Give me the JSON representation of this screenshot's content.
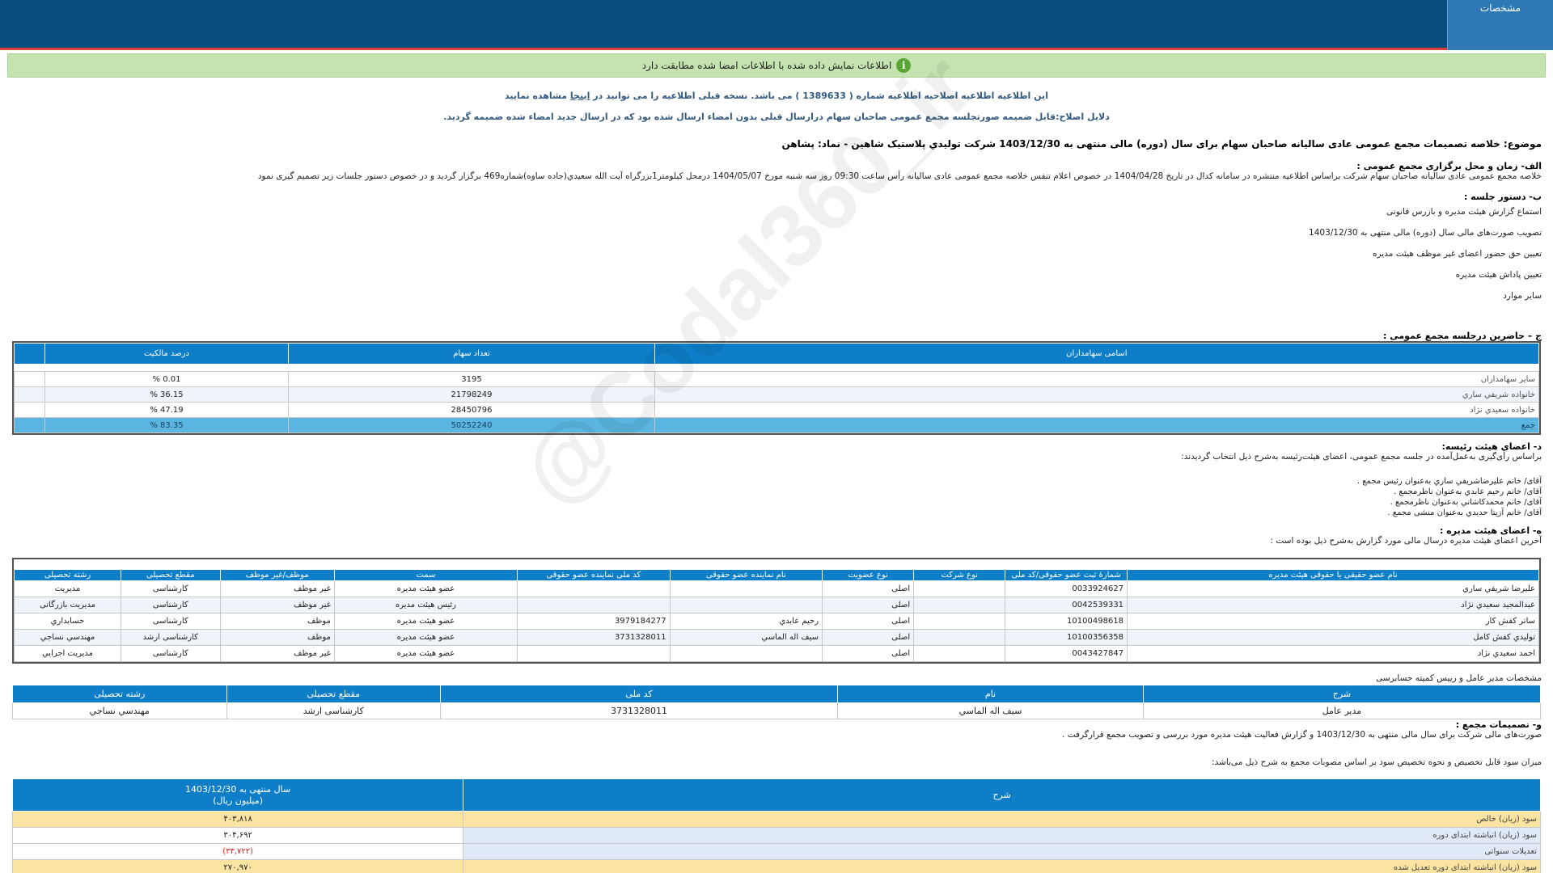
{
  "header": {
    "tab_label": "مشخصات"
  },
  "match_bar": {
    "text": "اطلاعات نمایش داده شده با اطلاعات امضا شده مطابقت دارد",
    "icon": "info-icon"
  },
  "notice": {
    "line1_a": "این اطلاعیه اطلاعیه اصلاحیه اطلاعیه شماره ( 1389633 ) می باشد. نسخه قبلی اطلاعیه را می توانید در",
    "link": "اینجا",
    "line1_b": "مشاهده نمایید",
    "line2": "دلایل اصلاح:قابل ضمیمه صورتجلسه مجمع عمومی صاحبان سهام درارسال قبلی بدون امضاء ارسال شده بود که در ارسال جدید امضاء شده ضمیمه گردید."
  },
  "subject": "موضوع: خلاصه تصمیمات مجمع عمومی عادی سالیانه صاحبان سهام برای سال (دوره) مالی منتهی به 1403/12/30 شرکت تولیدي پلاستیک شاهین - نماد: پشاهن",
  "section_a": {
    "title": "الف- زمان و محل برگزاری مجمع عمومی :",
    "text": "خلاصه مجمع عمومی عادی سالیانه صاحبان سهام شرکت براساس اطلاعیه منتشره در سامانه کدال در تاریخ 1404/04/28 در خصوص اعلام تنفس خلاصه مجمع عمومی عادی سالیانه رأس ساعت 09:30 روز سه شنبه مورخ 1404/05/07 درمحل  کیلومتر1بزرگراه آیت الله سعیدي(جاده ساوه)شماره469   برگزار گردید و در خصوص دستور جلسات زیر تصمیم گیری نمود"
  },
  "section_b": {
    "title": "ب- دستور جلسه :",
    "items": [
      "استماع گزارش هیئت مدیره و بازرس قانونی",
      "تصویب صورت‌های مالی سال (دوره) مالی منتهی به 1403/12/30",
      "تعیین حق حضور اعضای غیر موظف هیئت مدیره",
      "تعیین پاداش هیئت مدیره",
      "سایر موارد"
    ]
  },
  "section_c": {
    "title": "ج – حاضرین درجلسه مجمع عمومی :",
    "headers": [
      "اسامی سهامداران",
      "تعداد سهام",
      "درصد مالکیت"
    ],
    "rows": [
      [
        "سایر سهامداران",
        "3195",
        "0.01 %"
      ],
      [
        "خانواده شریفي ساري",
        "21798249",
        "36.15 %"
      ],
      [
        "خانواده سعیدي نژاد",
        "28450796",
        "47.19 %"
      ]
    ],
    "total": [
      "جمع",
      "50252240",
      "83.35 %"
    ]
  },
  "section_d": {
    "title": "د- اعضای هیئت رئیسه:",
    "intro": "براساس رأی‌گیری به‌عمل‌آمده در جلسه مجمع عمومی، اعضای هیئت‌رئیسه به‌شرح ذیل انتخاب گردیدند:",
    "members": [
      "آقای/ خانم  علیرضاشریفي ساري  به‌عنوان رئیس مجمع .",
      "آقای/ خانم  رحیم عابدي  به‌عنوان ناظرمجمع .",
      "آقای/ خانم  محمدکاشاني  به‌عنوان ناظرمجمع .",
      "آقای/ خانم  آزیتا حدیدي  به‌عنوان منشی مجمع ."
    ]
  },
  "section_e": {
    "title": "ه- اعضای هیئت مدیره :",
    "intro": "آخرین اعضای هیئت مدیره درسال مالی مورد گزارش به‌شرح ذیل بوده است :",
    "headers": [
      "نام عضو حقیقی یا حقوقی هیئت مدیره",
      "شمارۀ ثبت عضو حقوقی/کد ملی",
      "نوع شرکت",
      "نوع عضویت",
      "نام نماینده عضو حقوقی",
      "کد ملی نماینده عضو حقوقی",
      "سمت",
      "موظف/غیر موظف",
      "مقطع تحصیلی",
      "رشته تحصیلی"
    ],
    "rows": [
      [
        "علیرضا شریفي ساري",
        "0033924627",
        "",
        "اصلی",
        "",
        "",
        "عضو هیئت مدیره",
        "غیر موظف",
        "کارشناسی",
        "مدیریت"
      ],
      [
        "عبدالمجید سعیدي نژاد",
        "0042539331",
        "",
        "اصلی",
        "",
        "",
        "رئیس هیئت مدیره",
        "غیر موظف",
        "کارشناسی",
        "مدیریت بازرگانی"
      ],
      [
        "ساتر کفش کار",
        "10100498618",
        "",
        "اصلی",
        "رحیم عابدي",
        "3979184277",
        "عضو هیئت مدیره",
        "موظف",
        "کارشناسی",
        "حسابداري"
      ],
      [
        "تولیدي کفش کامل",
        "10100356358",
        "",
        "اصلی",
        "سیف اله الماسي",
        "3731328011",
        "عضو هیئت مدیره",
        "موظف",
        "کارشناسی ارشد",
        "مهندسي نساجي"
      ],
      [
        "احمد سعیدي نژاد",
        "0043427847",
        "",
        "اصلی",
        "",
        "",
        "عضو هیئت مدیره",
        "غیر موظف",
        "کارشناسی",
        "مدیریت اجرایي"
      ]
    ]
  },
  "ceo": {
    "title": "مشخصات مدیر عامل و رییس کمیته حسابرسی",
    "headers": [
      "شرح",
      "نام",
      "کد ملی",
      "مقطع تحصیلی",
      "رشته تحصیلی"
    ],
    "row": [
      "مدیر عامل",
      "سیف اله الماسي",
      "3731328011",
      "کارشناسی ارشد",
      "مهندسي نساجي"
    ]
  },
  "section_f": {
    "title": "و- تصمیمات مجمع :",
    "text": "صورت‌های مالی شرکت برای سال مالی منتهی به  1403/12/30 و گزارش فعالیت هیئت مدیره مورد بررسی و تصویب مجمع قرارگرفت .",
    "profit_intro": "میزان سود قابل تخصیص و نحوه تخصیص سود بر اساس مصوبات مجمع به شرح ذیل می‌باشد:"
  },
  "fin": {
    "header_desc": "شرح",
    "header_year": "سال منتهی به 1403/12/30",
    "header_unit": "(میلیون ریال)",
    "rows": [
      {
        "desc": "سود (زیان) خالص",
        "val": "۴۰۳,۸۱۸",
        "style": "hl"
      },
      {
        "desc": "سود (زیان) انباشته ابتدای دوره",
        "val": "۳۰۴,۶۹۲",
        "style": ""
      },
      {
        "desc": "تعدیلات سنواتی",
        "val": "(۳۳,۷۲۲)",
        "style": "neg"
      },
      {
        "desc": "سود (زیان) انباشته ابتدای دوره تعدیل شده",
        "val": "۲۷۰,۹۷۰",
        "style": "hl"
      }
    ]
  },
  "watermark": "@Codal360_ir"
}
